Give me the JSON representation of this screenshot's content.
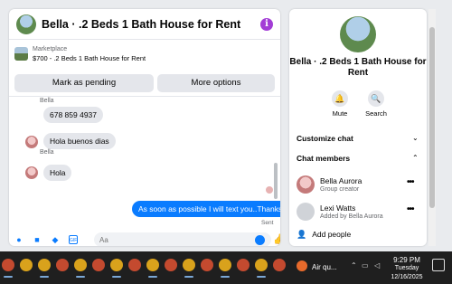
{
  "chat": {
    "title": "Bella · .2 Beds 1 Bath House for Rent",
    "marketplace_label": "Marketplace",
    "listing": "$700 - .2 Beds 1 Bath House for Rent",
    "buttons": {
      "pending": "Mark as pending",
      "more": "More options"
    },
    "messages": [
      {
        "sender": "Bella",
        "text": "678 859 4937"
      },
      {
        "text": "Hola buenos dias"
      },
      {
        "sender": "Bella",
        "text": "Hola"
      }
    ],
    "outgoing": "As soon as possible I will text you..Thanks",
    "status": "Sent",
    "composer": {
      "placeholder": "Aa"
    },
    "accent": "#0a7cff",
    "icons": [
      "microphone-icon",
      "image-icon",
      "sticker-icon",
      "gif-icon",
      "emoji-icon",
      "like-icon",
      "info-icon"
    ]
  },
  "side": {
    "title": "Bella · .2 Beds 1 Bath House for Rent",
    "actions": [
      {
        "label": "Mute",
        "icon": "bell-icon"
      },
      {
        "label": "Search",
        "icon": "search-icon"
      }
    ],
    "sections": {
      "customize": "Customize chat",
      "members": "Chat members"
    },
    "members": [
      {
        "name": "Bella Aurora",
        "sub": "Group creator"
      },
      {
        "name": "Lexi Watts",
        "sub": "Added by Bella Aurora"
      }
    ],
    "add_people": "Add people"
  },
  "taskbar": {
    "weather": "Air qu...",
    "time": "9:29 PM",
    "day": "Tuesday",
    "date": "12/16/2025"
  }
}
